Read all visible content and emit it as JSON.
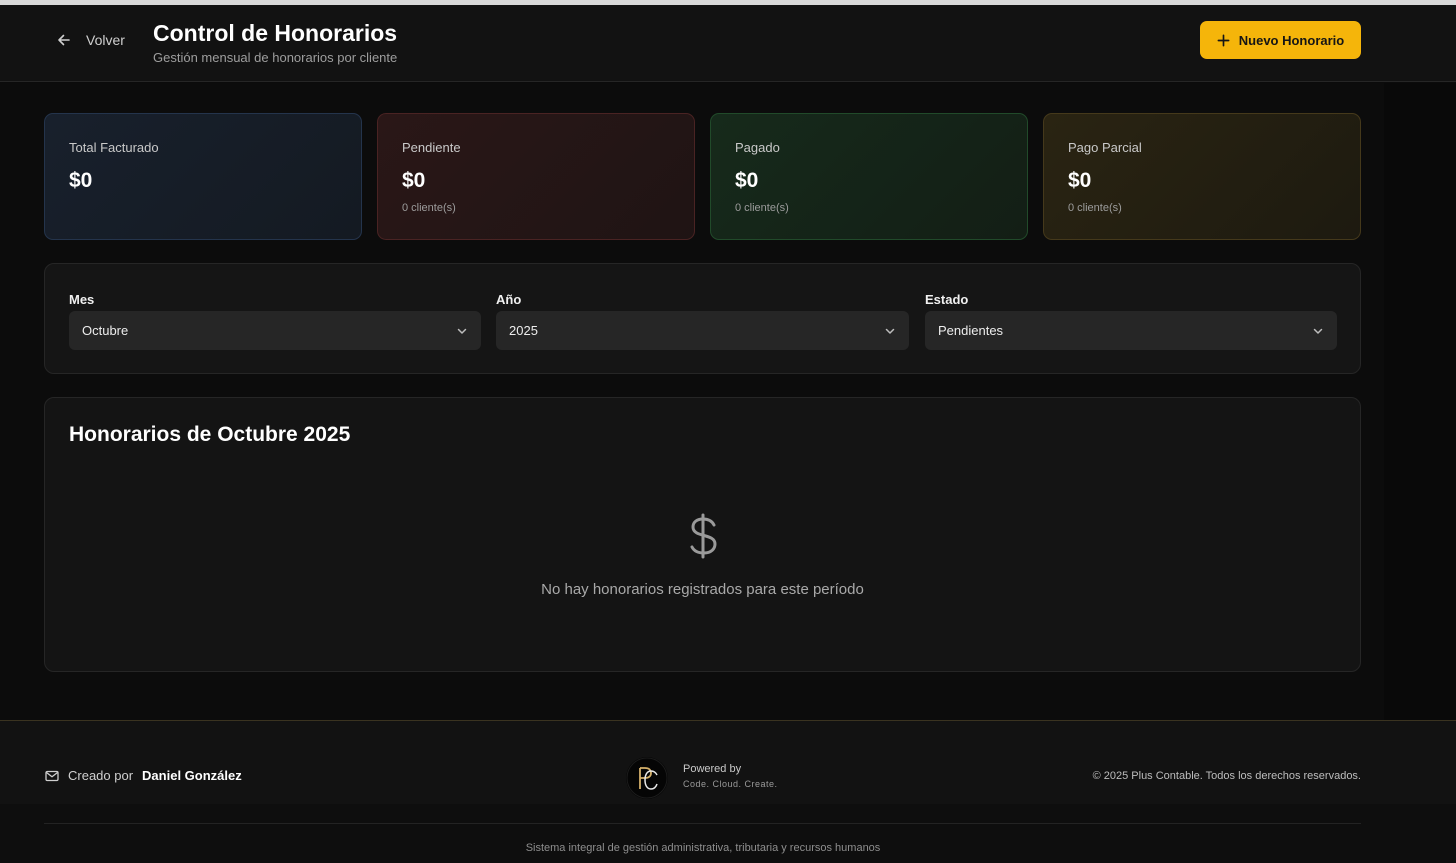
{
  "header": {
    "back_label": "Volver",
    "title": "Control de Honorarios",
    "subtitle": "Gestión mensual de honorarios por cliente",
    "new_button_label": "Nuevo Honorario"
  },
  "summary_cards": [
    {
      "label": "Total Facturado",
      "amount": "$0",
      "sub": ""
    },
    {
      "label": "Pendiente",
      "amount": "$0",
      "sub": "0 cliente(s)"
    },
    {
      "label": "Pagado",
      "amount": "$0",
      "sub": "0 cliente(s)"
    },
    {
      "label": "Pago Parcial",
      "amount": "$0",
      "sub": "0 cliente(s)"
    }
  ],
  "filters": {
    "month": {
      "label": "Mes",
      "value": "Octubre"
    },
    "year": {
      "label": "Año",
      "value": "2025"
    },
    "status": {
      "label": "Estado",
      "value": "Pendientes"
    }
  },
  "list": {
    "title": "Honorarios de Octubre 2025",
    "empty_message": "No hay honorarios registrados para este período"
  },
  "footer": {
    "created_by_prefix": "Creado por",
    "created_by_name": "Daniel González",
    "powered_by": "Powered by",
    "powered_tagline": "Code. Cloud. Create.",
    "copyright": "© 2025 Plus Contable. Todos los derechos reservados.",
    "system_tagline": "Sistema integral de gestión administrativa, tributaria y recursos humanos"
  },
  "colors": {
    "accent": "#f5b50a",
    "card_blue": "#18202c",
    "card_red": "#2a1717",
    "card_green": "#162a1b",
    "card_yellow": "#2a2412"
  },
  "icons": [
    "arrow-left-icon",
    "plus-icon",
    "chevron-down-icon",
    "dollar-icon",
    "mail-icon"
  ]
}
